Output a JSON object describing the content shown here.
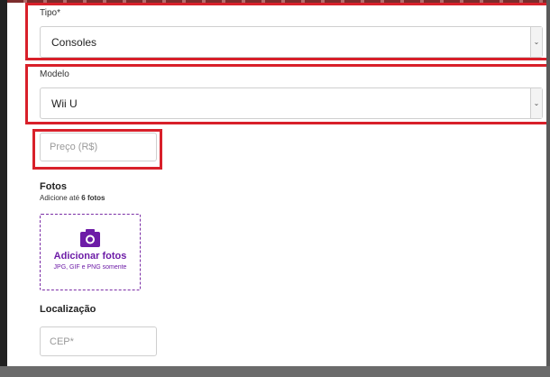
{
  "tipo": {
    "label": "Tipo*",
    "value": "Consoles"
  },
  "modelo": {
    "label": "Modelo",
    "value": "Wii U"
  },
  "preco": {
    "placeholder": "Preço (R$)"
  },
  "fotos": {
    "title": "Fotos",
    "hint_prefix": "Adicione até ",
    "hint_bold": "6 fotos",
    "add_label": "Adicionar fotos",
    "formats": "JPG, GIF e PNG somente"
  },
  "localizacao": {
    "title": "Localização",
    "cep_placeholder": "CEP*"
  },
  "colors": {
    "highlight": "#d8202a",
    "accent": "#6d1ca7"
  },
  "icons": {
    "photo": "camera-icon",
    "dropdown": "chevron-down-icon"
  }
}
